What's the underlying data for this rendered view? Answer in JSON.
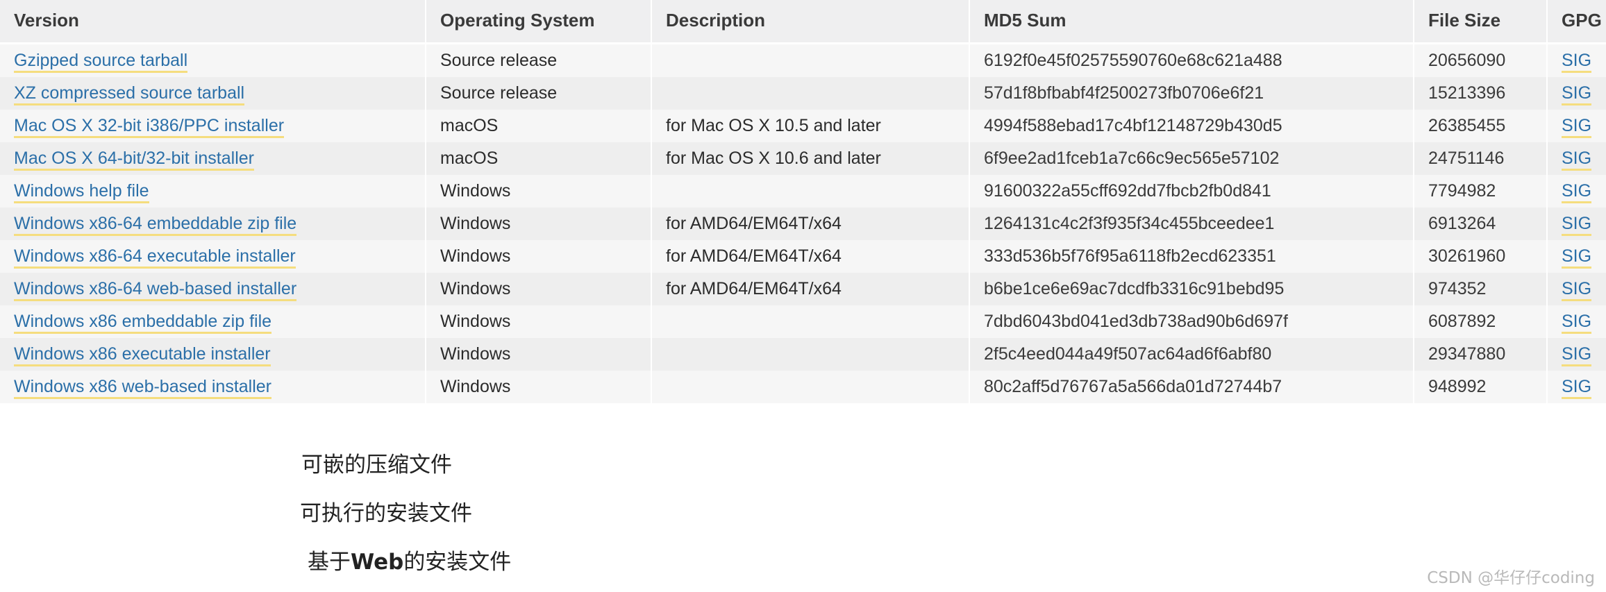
{
  "table": {
    "columns": [
      {
        "key": "version",
        "label": "Version"
      },
      {
        "key": "os",
        "label": "Operating System"
      },
      {
        "key": "description",
        "label": "Description"
      },
      {
        "key": "md5",
        "label": "MD5 Sum"
      },
      {
        "key": "filesize",
        "label": "File Size"
      },
      {
        "key": "gpg",
        "label": "GPG"
      }
    ],
    "rows": [
      {
        "version": "Gzipped source tarball",
        "os": "Source release",
        "description": "",
        "md5": "6192f0e45f02575590760e68c621a488",
        "filesize": "20656090",
        "gpg": "SIG"
      },
      {
        "version": "XZ compressed source tarball",
        "os": "Source release",
        "description": "",
        "md5": "57d1f8bfbabf4f2500273fb0706e6f21",
        "filesize": "15213396",
        "gpg": "SIG"
      },
      {
        "version": "Mac OS X 32-bit i386/PPC installer",
        "os": "macOS",
        "description": "for Mac OS X 10.5 and later",
        "md5": "4994f588ebad17c4bf12148729b430d5",
        "filesize": "26385455",
        "gpg": "SIG"
      },
      {
        "version": "Mac OS X 64-bit/32-bit installer",
        "os": "macOS",
        "description": "for Mac OS X 10.6 and later",
        "md5": "6f9ee2ad1fceb1a7c66c9ec565e57102",
        "filesize": "24751146",
        "gpg": "SIG"
      },
      {
        "version": "Windows help file",
        "os": "Windows",
        "description": "",
        "md5": "91600322a55cff692dd7fbcb2fb0d841",
        "filesize": "7794982",
        "gpg": "SIG"
      },
      {
        "version": "Windows x86-64 embeddable zip file",
        "os": "Windows",
        "description": "for AMD64/EM64T/x64",
        "md5": "1264131c4c2f3f935f34c455bceedee1",
        "filesize": "6913264",
        "gpg": "SIG"
      },
      {
        "version": "Windows x86-64 executable installer",
        "os": "Windows",
        "description": "for AMD64/EM64T/x64",
        "md5": "333d536b5f76f95a6118fb2ecd623351",
        "filesize": "30261960",
        "gpg": "SIG"
      },
      {
        "version": "Windows x86-64 web-based installer",
        "os": "Windows",
        "description": "for AMD64/EM64T/x64",
        "md5": "b6be1ce6e69ac7dcdfb3316c91bebd95",
        "filesize": "974352",
        "gpg": "SIG"
      },
      {
        "version": "Windows x86 embeddable zip file",
        "os": "Windows",
        "description": "",
        "md5": "7dbd6043bd041ed3db738ad90b6d697f",
        "filesize": "6087892",
        "gpg": "SIG"
      },
      {
        "version": "Windows x86 executable installer",
        "os": "Windows",
        "description": "",
        "md5": "2f5c4eed044a49f507ac64ad6f6abf80",
        "filesize": "29347880",
        "gpg": "SIG"
      },
      {
        "version": "Windows x86 web-based installer",
        "os": "Windows",
        "description": "",
        "md5": "80c2aff5d76767a5a566da01d72744b7",
        "filesize": "948992",
        "gpg": "SIG"
      }
    ]
  },
  "annotations": [
    {
      "text": "可嵌的压缩文件"
    },
    {
      "text": "可执行的安装文件"
    },
    {
      "text_prefix": "基于",
      "text_bold": "Web",
      "text_suffix": "的安装文件"
    }
  ],
  "watermark": {
    "text": "CSDN @华仔仔coding"
  },
  "colors": {
    "link": "#2b6fa8",
    "link_underline": "#f5dd7e",
    "header_bg": "#efeff0",
    "row_odd_bg": "#f6f6f6",
    "row_even_bg": "#eeeeee",
    "text": "#3a3a3a"
  }
}
